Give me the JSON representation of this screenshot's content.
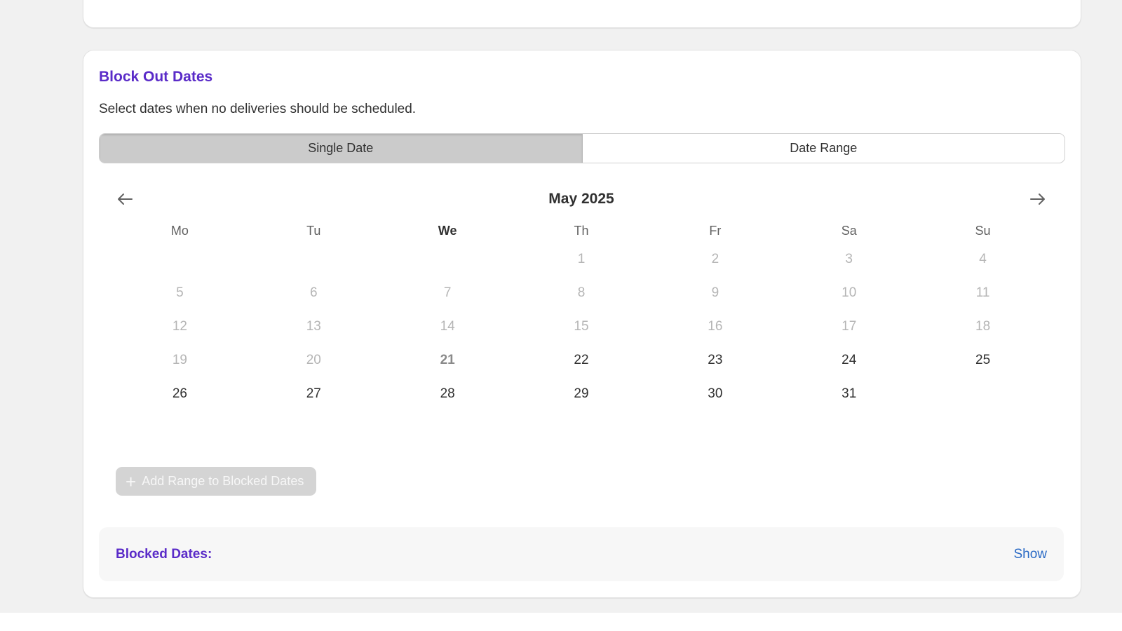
{
  "card": {
    "title": "Block Out Dates",
    "description": "Select dates when no deliveries should be scheduled."
  },
  "mode_toggle": {
    "options": [
      "Single Date",
      "Date Range"
    ],
    "selected": "Single Date"
  },
  "calendar": {
    "month_label": "May 2025",
    "prev_icon": "arrow-left-icon",
    "next_icon": "arrow-right-icon",
    "weekdays": [
      "Mo",
      "Tu",
      "We",
      "Th",
      "Fr",
      "Sa",
      "Su"
    ],
    "today_weekday_index": 2,
    "leading_blank_days": 3,
    "days": [
      {
        "label": "1",
        "state": "disabled"
      },
      {
        "label": "2",
        "state": "disabled"
      },
      {
        "label": "3",
        "state": "disabled"
      },
      {
        "label": "4",
        "state": "disabled"
      },
      {
        "label": "5",
        "state": "disabled"
      },
      {
        "label": "6",
        "state": "disabled"
      },
      {
        "label": "7",
        "state": "disabled"
      },
      {
        "label": "8",
        "state": "disabled"
      },
      {
        "label": "9",
        "state": "disabled"
      },
      {
        "label": "10",
        "state": "disabled"
      },
      {
        "label": "11",
        "state": "disabled"
      },
      {
        "label": "12",
        "state": "disabled"
      },
      {
        "label": "13",
        "state": "disabled"
      },
      {
        "label": "14",
        "state": "disabled"
      },
      {
        "label": "15",
        "state": "disabled"
      },
      {
        "label": "16",
        "state": "disabled"
      },
      {
        "label": "17",
        "state": "disabled"
      },
      {
        "label": "18",
        "state": "disabled"
      },
      {
        "label": "19",
        "state": "disabled"
      },
      {
        "label": "20",
        "state": "disabled"
      },
      {
        "label": "21",
        "state": "today"
      },
      {
        "label": "22",
        "state": "available"
      },
      {
        "label": "23",
        "state": "available"
      },
      {
        "label": "24",
        "state": "available"
      },
      {
        "label": "25",
        "state": "available"
      },
      {
        "label": "26",
        "state": "available"
      },
      {
        "label": "27",
        "state": "available"
      },
      {
        "label": "28",
        "state": "available"
      },
      {
        "label": "29",
        "state": "available"
      },
      {
        "label": "30",
        "state": "available"
      },
      {
        "label": "31",
        "state": "available"
      }
    ]
  },
  "add_button": {
    "label": "Add Range to Blocked Dates",
    "icon": "plus-icon",
    "disabled": true
  },
  "blocked_panel": {
    "label": "Blocked Dates:",
    "toggle_link": "Show"
  },
  "colors": {
    "accent": "#5a2bc8",
    "link": "#2a6ac5",
    "toggle_active": "#cbcbcb",
    "disabled_button": "#d4d4d4"
  }
}
